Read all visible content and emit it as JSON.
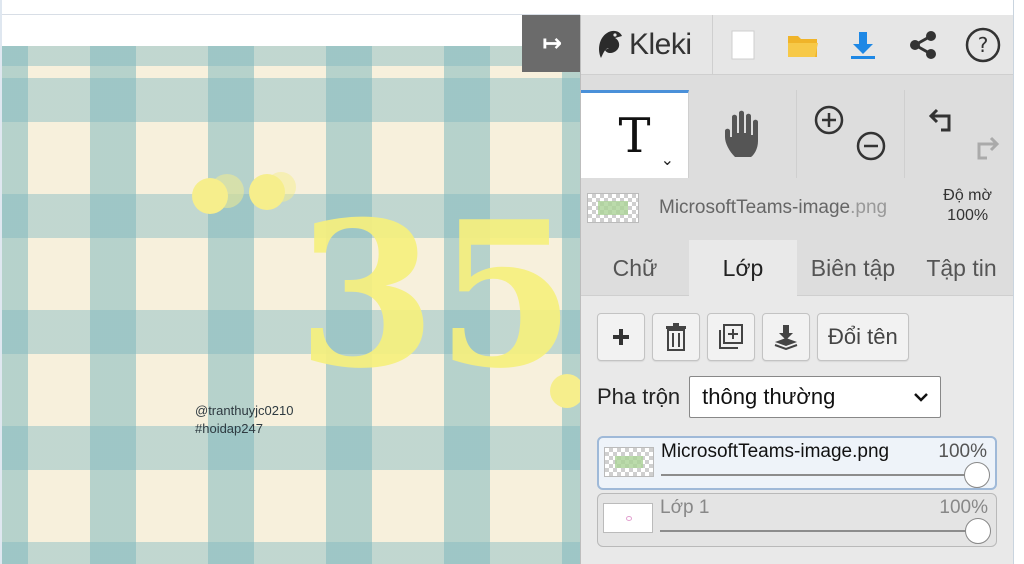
{
  "canvas": {
    "watermark_line1": "@tranthuyjc0210",
    "watermark_line2": "#hoidap247",
    "digits": "35"
  },
  "topbar": {
    "logo_text": "Kleki",
    "icons": [
      "new-document-icon",
      "open-folder-icon",
      "download-icon",
      "share-icon",
      "help-icon"
    ]
  },
  "tools": {
    "text_glyph": "T",
    "chevron": "⌄"
  },
  "active_layer": {
    "name": "MicrosoftTeams-image",
    "ext": ".png",
    "opacity_label": "Độ mờ",
    "opacity_value": "100%"
  },
  "tabs": [
    {
      "label": "Chữ",
      "active": false
    },
    {
      "label": "Lớp",
      "active": true
    },
    {
      "label": "Biên tập",
      "active": false
    },
    {
      "label": "Tập tin",
      "active": false
    }
  ],
  "layer_panel": {
    "rename_label": "Đổi tên",
    "blend_label": "Pha trộn",
    "blend_value": "thông thường"
  },
  "layers": [
    {
      "name": "MicrosoftTeams-image.png",
      "opacity": "100%",
      "opacity_fraction": 1.0,
      "selected": true
    },
    {
      "name": "Lớp 1",
      "opacity": "100%",
      "opacity_fraction": 1.0,
      "selected": false
    }
  ],
  "colors": {
    "accent": "#4a90d9",
    "collapse_button": "#6b6b6b",
    "download_icon": "#1e88e5",
    "folder_icon": "#f0b429"
  }
}
